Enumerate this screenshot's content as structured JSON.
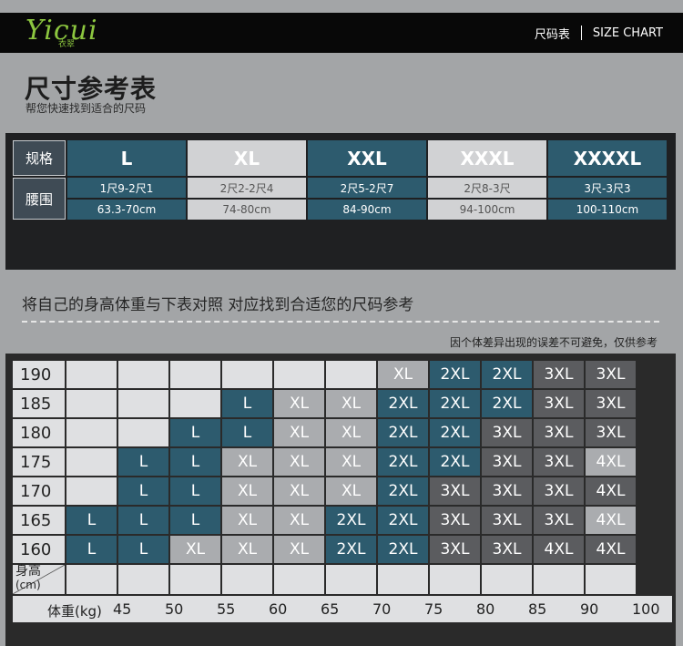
{
  "header": {
    "logo_text": "Yicui",
    "logo_cn": "衣翠",
    "nav_cn": "尺码表",
    "nav_en": "SIZE CHART"
  },
  "title": "尺寸参考表",
  "subtitle": "帮您快速找到适合的尺码",
  "size_table": {
    "row_labels": [
      "规格",
      "腰围"
    ],
    "sizes": [
      {
        "size": "L",
        "waist_chi": "1尺9-2尺1",
        "waist_cm": "63.3-70cm",
        "tone": "teal"
      },
      {
        "size": "XL",
        "waist_chi": "2尺2-2尺4",
        "waist_cm": "74-80cm",
        "tone": "light"
      },
      {
        "size": "XXL",
        "waist_chi": "2尺5-2尺7",
        "waist_cm": "84-90cm",
        "tone": "teal"
      },
      {
        "size": "XXXL",
        "waist_chi": "2尺8-3尺",
        "waist_cm": "94-100cm",
        "tone": "light"
      },
      {
        "size": "XXXXL",
        "waist_chi": "3尺-3尺3",
        "waist_cm": "100-110cm",
        "tone": "teal"
      }
    ]
  },
  "instruction": "将自己的身高体重与下表对照 对应找到合适您的尺码参考",
  "note": "因个体差异出现的误差不可避免，仅供参考",
  "chart": {
    "height_label": "身高",
    "height_unit": "(cm)",
    "weight_label": "体重(kg)",
    "weights": [
      "45",
      "50",
      "55",
      "60",
      "65",
      "70",
      "75",
      "80",
      "85",
      "90",
      "100"
    ],
    "rows": [
      {
        "height": "190",
        "cells": [
          "",
          "",
          "",
          "",
          "",
          "",
          "XL",
          "2XL",
          "2XL",
          "3XL",
          "3XL"
        ]
      },
      {
        "height": "185",
        "cells": [
          "",
          "",
          "",
          "L",
          "XL",
          "XL",
          "2XL",
          "2XL",
          "2XL",
          "3XL",
          "3XL"
        ]
      },
      {
        "height": "180",
        "cells": [
          "",
          "",
          "L",
          "L",
          "XL",
          "XL",
          "2XL",
          "2XL",
          "3XL",
          "3XL",
          "3XL"
        ]
      },
      {
        "height": "175",
        "cells": [
          "",
          "L",
          "L",
          "XL",
          "XL",
          "XL",
          "2XL",
          "2XL",
          "3XL",
          "3XL",
          "4XL"
        ]
      },
      {
        "height": "170",
        "cells": [
          "",
          "L",
          "L",
          "XL",
          "XL",
          "XL",
          "2XL",
          "3XL",
          "3XL",
          "3XL",
          "4XL"
        ]
      },
      {
        "height": "165",
        "cells": [
          "L",
          "L",
          "L",
          "XL",
          "XL",
          "2XL",
          "2XL",
          "3XL",
          "3XL",
          "3XL",
          "4XL"
        ]
      },
      {
        "height": "160",
        "cells": [
          "L",
          "L",
          "XL",
          "XL",
          "XL",
          "2XL",
          "2XL",
          "3XL",
          "3XL",
          "4XL",
          "4XL"
        ]
      }
    ],
    "tones": [
      [
        "e",
        "e",
        "e",
        "e",
        "e",
        "e",
        "m",
        "t",
        "t",
        "d",
        "d"
      ],
      [
        "e",
        "e",
        "e",
        "t",
        "m",
        "m",
        "t",
        "t",
        "t",
        "d",
        "d"
      ],
      [
        "e",
        "e",
        "t",
        "t",
        "m",
        "m",
        "t",
        "t",
        "d",
        "d",
        "d"
      ],
      [
        "e",
        "t",
        "t",
        "m",
        "m",
        "m",
        "t",
        "t",
        "d",
        "d",
        "m"
      ],
      [
        "e",
        "t",
        "t",
        "m",
        "m",
        "m",
        "t",
        "d",
        "d",
        "d",
        "d"
      ],
      [
        "t",
        "t",
        "t",
        "m",
        "m",
        "t",
        "t",
        "d",
        "d",
        "d",
        "m"
      ],
      [
        "t",
        "t",
        "m",
        "m",
        "m",
        "t",
        "t",
        "d",
        "d",
        "d",
        "d"
      ]
    ]
  },
  "colors": {
    "teal": "#2d5b6e",
    "light_gray": "#d1d2d4",
    "mid_gray": "#aaacaf",
    "dark_gray": "#5b5c5f",
    "empty": "#dfe0e2",
    "logo_green": "#8cc63f"
  }
}
